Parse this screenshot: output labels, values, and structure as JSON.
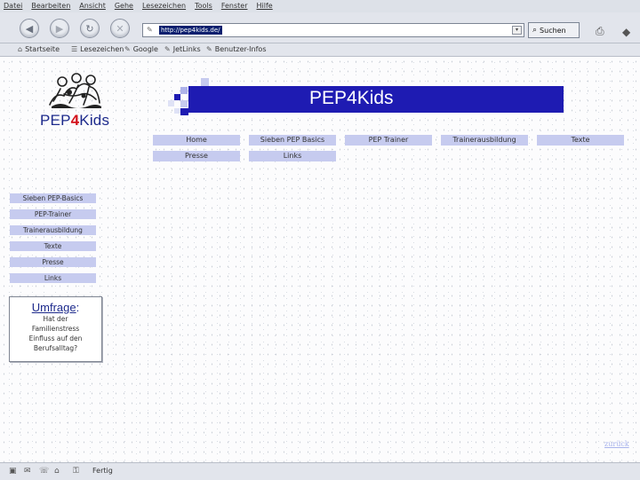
{
  "menu": [
    "Datei",
    "Bearbeiten",
    "Ansicht",
    "Gehe",
    "Lesezeichen",
    "Tools",
    "Fenster",
    "Hilfe"
  ],
  "nav": {
    "back_glyph": "◀",
    "forward_glyph": "▶",
    "reload_glyph": "↻",
    "stop_glyph": "✕",
    "url": "http://pep4kids.de/",
    "search_label": "Suchen"
  },
  "bookmarks": [
    "Startseite",
    "Lesezeichen",
    "Google",
    "JetLinks",
    "Benutzer-Infos"
  ],
  "site": {
    "logo_prefix": "PEP",
    "logo_four": "4",
    "logo_suffix": "Kids",
    "banner_title": "PEP4Kids",
    "top_nav": [
      "Home",
      "Sieben PEP Basics",
      "PEP Trainer",
      "Trainerausbildung",
      "Texte",
      "Presse",
      "Links"
    ],
    "side_nav": [
      "Sieben PEP-Basics",
      "PEP-Trainer",
      "Trainerausbildung",
      "Texte",
      "Presse",
      "Links"
    ],
    "poll": {
      "title": "Umfrage",
      "colon": ":",
      "question_lines": [
        "Hat der",
        "Familienstress",
        "Einfluss auf den",
        "Berufsalltag?"
      ]
    },
    "back_link": "zurück"
  },
  "status": {
    "text": "Fertig"
  },
  "colors": {
    "banner": "#1e1bb2",
    "nav_button": "#c6cbef",
    "logo_blue": "#1d2a8c",
    "logo_red": "#d3121b"
  }
}
